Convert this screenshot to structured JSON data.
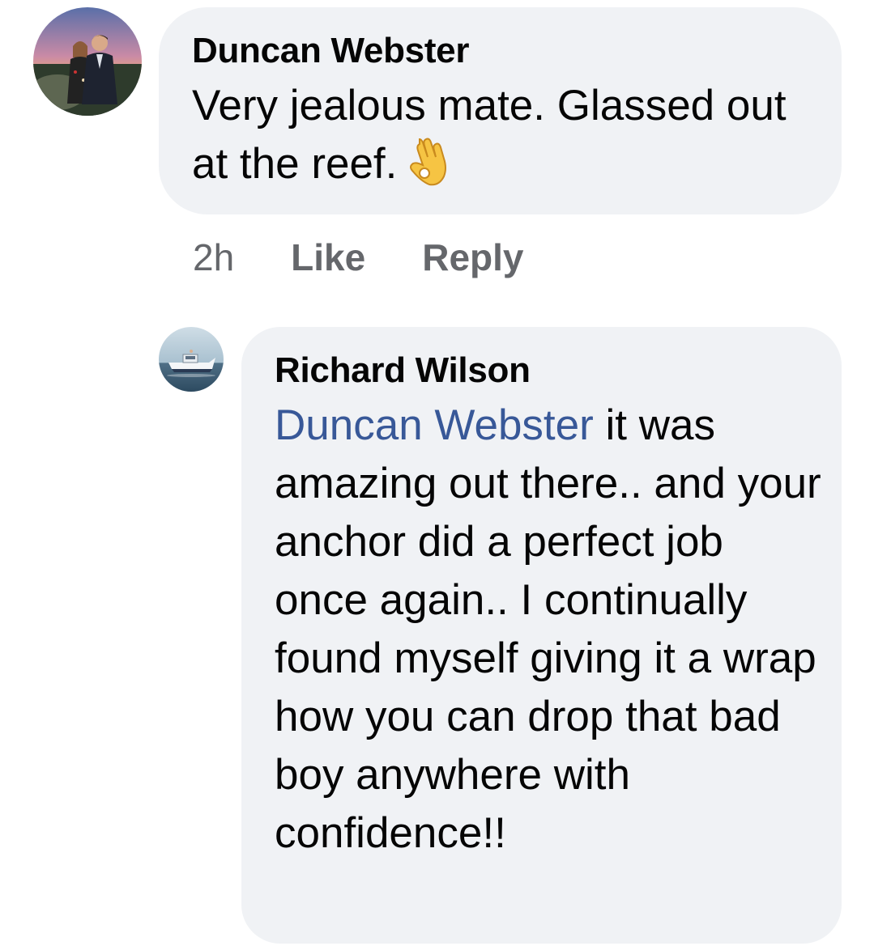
{
  "comments": [
    {
      "author": "Duncan Webster",
      "text": "Very jealous mate. Glassed out at the reef.",
      "emoji": "ok-hand-emoji",
      "time": "2h",
      "like_label": "Like",
      "reply_label": "Reply"
    },
    {
      "author": "Richard Wilson",
      "mention": "Duncan Webster",
      "text": "it was amazing out there.. and your anchor did a perfect job once again.. I continually found myself giving it a wrap how you can drop that bad boy anywhere with confidence!!"
    }
  ],
  "colors": {
    "bubble": "#f0f2f5",
    "mention": "#385898",
    "meta": "#65676b",
    "text": "#050505"
  }
}
